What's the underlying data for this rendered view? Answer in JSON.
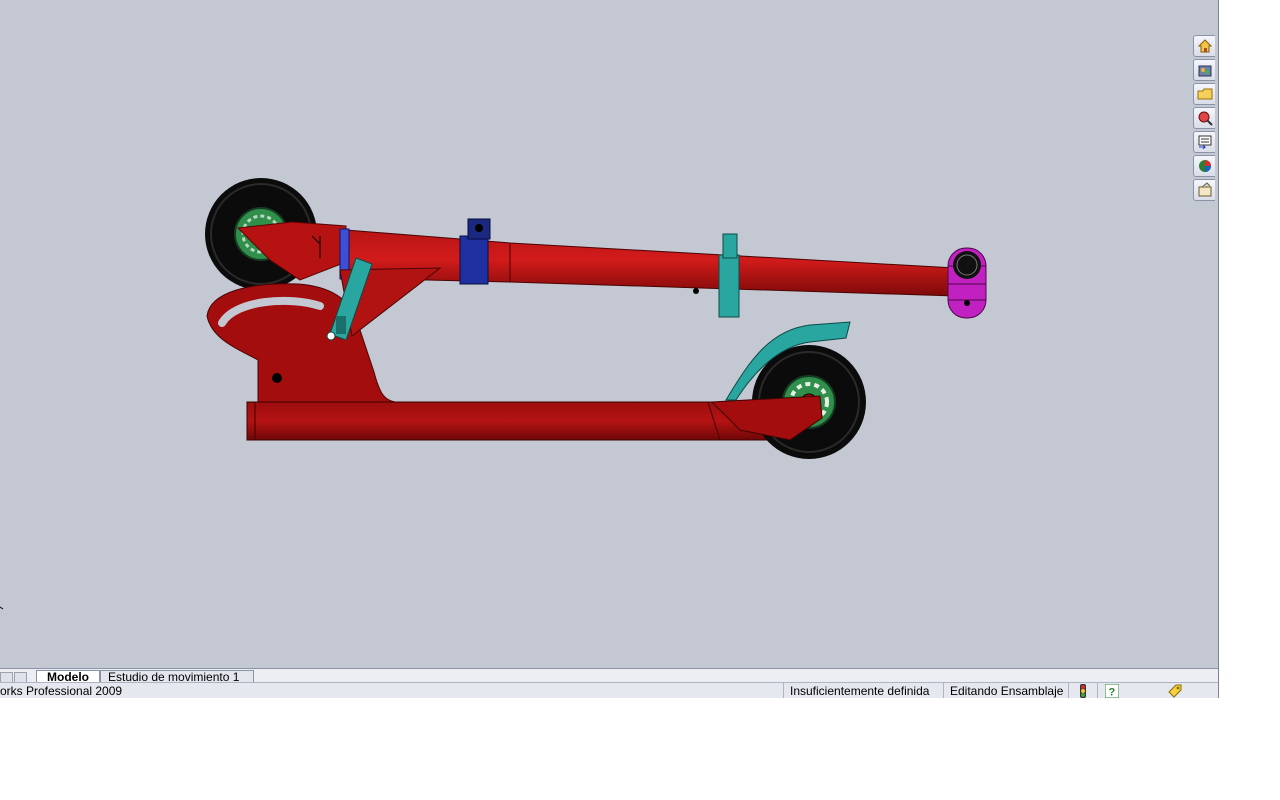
{
  "tabs": {
    "items": [
      {
        "label": "Modelo",
        "active": true
      },
      {
        "label": "Estudio de movimiento 1",
        "active": false
      }
    ]
  },
  "status": {
    "app_text": "orks Professional 2009",
    "definition": "Insuficientemente definida",
    "mode": "Editando Ensamblaje"
  },
  "taskpane": {
    "icons": [
      "home-icon",
      "design-library-icon",
      "file-explorer-icon",
      "search-icon",
      "view-palette-icon",
      "appearances-icon",
      "custom-properties-icon"
    ]
  },
  "colors": {
    "viewport_bg": "#c4c8d2",
    "frame_red": "#a30d0d",
    "clamp_teal": "#2aa6a0",
    "collar_blue": "#1e2fa0",
    "grip_magenta": "#c021c0",
    "hub_green": "#2f8f4b",
    "tire_black": "#0b0b0b"
  }
}
